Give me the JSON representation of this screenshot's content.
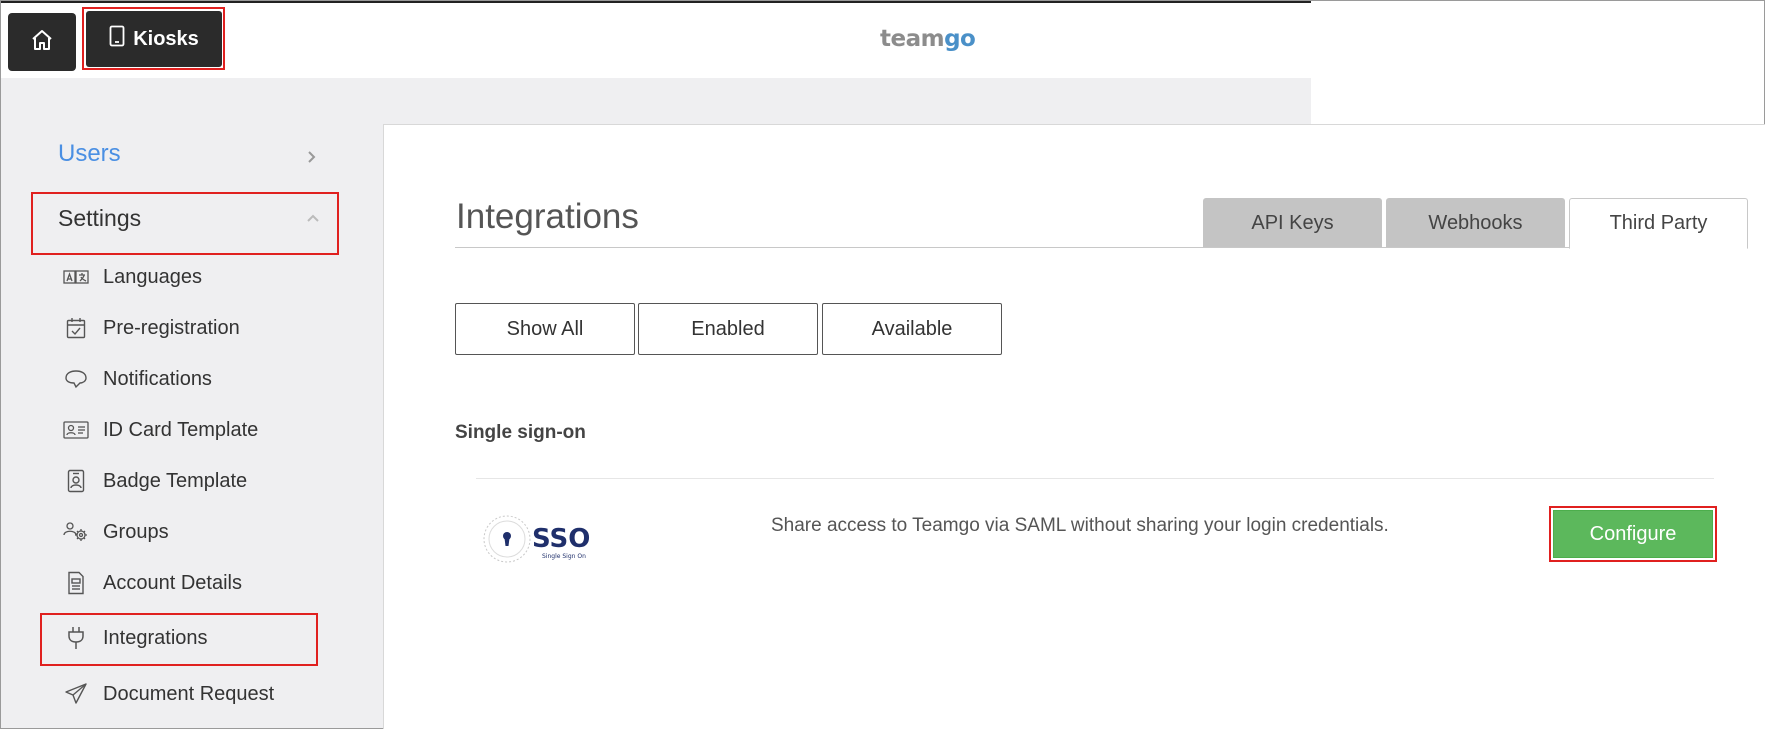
{
  "topbar": {
    "kiosks_label": "Kiosks",
    "logo_part1": "team",
    "logo_part2": "go"
  },
  "sidebar": {
    "users_label": "Users",
    "settings_label": "Settings",
    "items": [
      {
        "label": "Languages",
        "icon": "languages-icon"
      },
      {
        "label": "Pre-registration",
        "icon": "calendar-check-icon"
      },
      {
        "label": "Notifications",
        "icon": "megaphone-icon"
      },
      {
        "label": "ID Card Template",
        "icon": "id-card-icon"
      },
      {
        "label": "Badge Template",
        "icon": "badge-icon"
      },
      {
        "label": "Groups",
        "icon": "groups-gear-icon"
      },
      {
        "label": "Account Details",
        "icon": "account-details-icon"
      },
      {
        "label": "Integrations",
        "icon": "plug-icon"
      },
      {
        "label": "Document Request",
        "icon": "send-icon"
      }
    ]
  },
  "main": {
    "title": "Integrations",
    "tabs": [
      {
        "label": "API Keys",
        "active": false
      },
      {
        "label": "Webhooks",
        "active": false
      },
      {
        "label": "Third Party",
        "active": true
      }
    ],
    "filters": [
      "Show All",
      "Enabled",
      "Available"
    ],
    "section_title": "Single sign-on",
    "sso": {
      "logo_text": "SSO",
      "logo_subtext": "Single Sign On",
      "description": "Share access to Teamgo via SAML without sharing your login credentials.",
      "configure_label": "Configure"
    }
  },
  "colors": {
    "highlight": "#e0201f",
    "link_blue": "#4a8fe3",
    "configure_green": "#5cb85c",
    "dark_button": "#2b2b2b",
    "tab_inactive": "#c4c4c4"
  }
}
